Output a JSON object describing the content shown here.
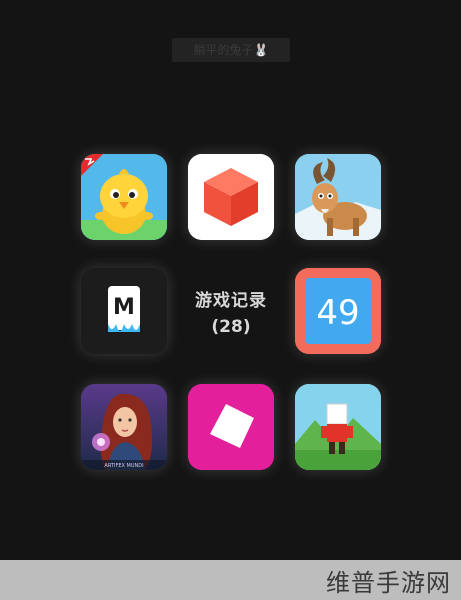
{
  "top_watermark": "躺平的兔子🐰",
  "folder": {
    "title": "游戏记录",
    "count": "(28)"
  },
  "apps": [
    {
      "icon": "yellow-chick-app-icon"
    },
    {
      "icon": "red-cube-app-icon"
    },
    {
      "icon": "goat-app-icon"
    },
    {
      "icon": "m-letter-app-icon",
      "logo_text": "M"
    },
    {
      "icon": "49-app-icon",
      "logo_text": "49"
    },
    {
      "icon": "fantasy-woman-app-icon",
      "logo_text": "ARTIFEX MUNDI"
    },
    {
      "icon": "pink-square-app-icon"
    },
    {
      "icon": "blocky-runner-app-icon"
    }
  ],
  "footer": {
    "brand": "维普手游网"
  },
  "colors": {
    "background": "#141414",
    "label": "#d8d8d8",
    "footer_bar": "#bdbdbd"
  }
}
